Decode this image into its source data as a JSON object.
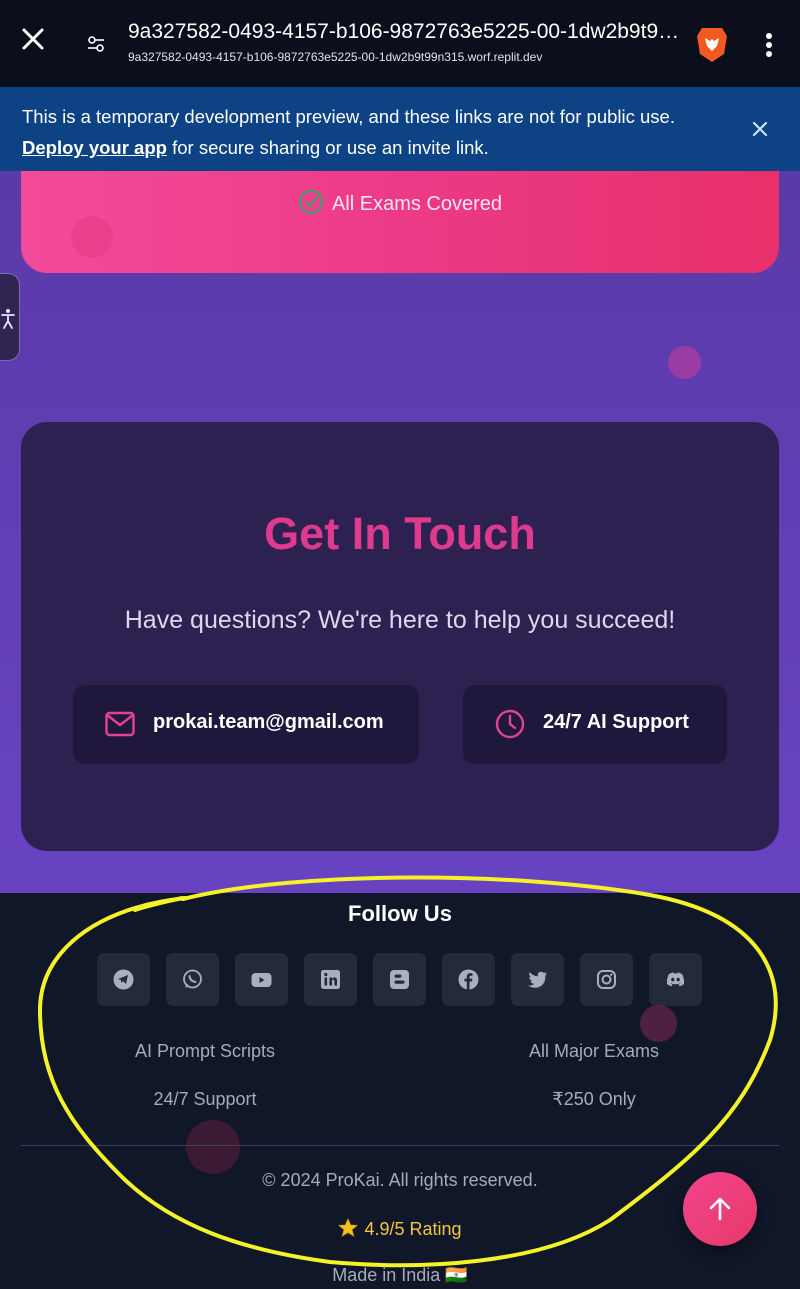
{
  "browser": {
    "title": "9a327582-0493-4157-b106-9872763e5225-00-1dw2b9t99n315.worf.replit.dev",
    "url": "9a327582-0493-4157-b106-9872763e5225-00-1dw2b9t99n315.worf.replit.dev",
    "icons": [
      "close-icon",
      "site-settings-icon",
      "brave-lion-icon",
      "more-vertical-icon"
    ]
  },
  "banner": {
    "message": "This is a temporary development preview, and these links are not for public use.",
    "link_text": "Deploy your app",
    "message_tail": " for secure sharing or use an invite link."
  },
  "hero_card": {
    "feature": "All Exams Covered",
    "icon": "check-circle-icon"
  },
  "contact": {
    "title": "Get In Touch",
    "subtitle": "Have questions? We're here to help you succeed!",
    "email": "prokai.team@gmail.com",
    "support": "24/7 AI Support"
  },
  "footer": {
    "follow_title": "Follow Us",
    "socials": [
      "telegram-icon",
      "whatsapp-icon",
      "youtube-icon",
      "linkedin-icon",
      "blogger-icon",
      "facebook-icon",
      "twitter-icon",
      "instagram-icon",
      "discord-icon"
    ],
    "features": [
      "AI Prompt Scripts",
      "All Major Exams",
      "24/7 Support",
      "₹250 Only"
    ],
    "copyright": "© 2024 ProKai. All rights reserved.",
    "rating": "4.9/5 Rating",
    "made_in": "Made in India 🇮🇳"
  },
  "colors": {
    "accent_pink": "#de3b8e",
    "purple_bg": "#6240b8",
    "footer_bg": "#0f1729",
    "banner_bg": "#0d4384",
    "highlight_yellow": "#f5f228"
  }
}
